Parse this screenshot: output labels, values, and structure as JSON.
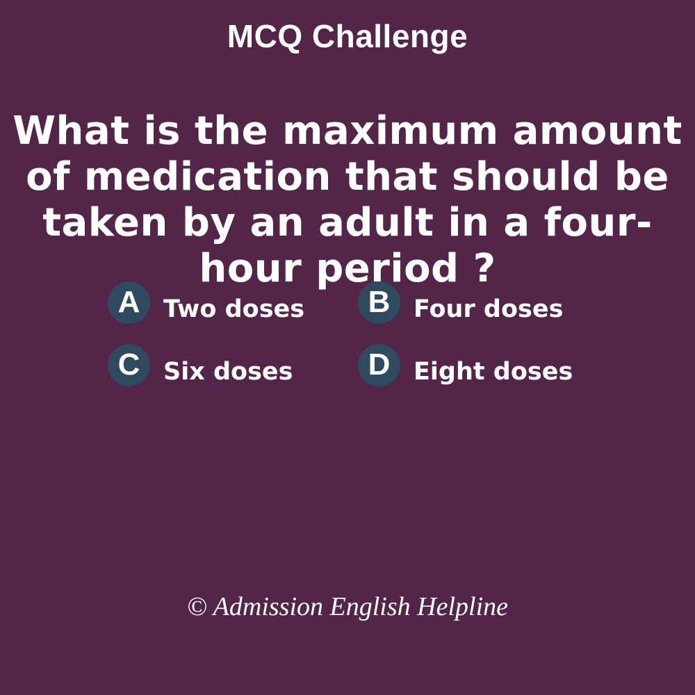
{
  "header": {
    "title": "MCQ Challenge"
  },
  "question": {
    "lines": [
      "What is the maximum amount",
      "of medication that should be",
      "taken by an adult in a four-",
      "hour period ?"
    ]
  },
  "options": [
    {
      "letter": "A",
      "text": "Two doses"
    },
    {
      "letter": "B",
      "text": "Four doses"
    },
    {
      "letter": "C",
      "text": "Six doses"
    },
    {
      "letter": "D",
      "text": "Eight doses"
    }
  ],
  "footer": {
    "credit": "© Admission English Helpline"
  },
  "colors": {
    "background": "#532548",
    "badge": "#2f4a5e",
    "text": "#ffffff"
  }
}
